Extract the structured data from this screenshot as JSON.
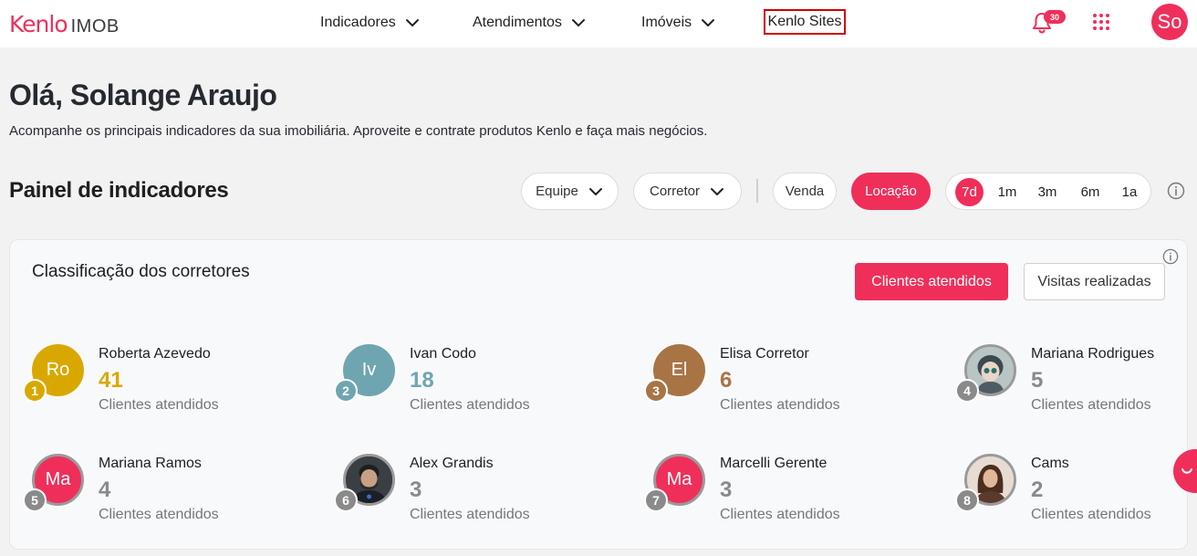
{
  "header": {
    "brand": "Kenlo",
    "product": "IMOB",
    "nav": [
      {
        "label": "Indicadores"
      },
      {
        "label": "Atendimentos"
      },
      {
        "label": "Imóveis"
      }
    ],
    "sites_label": "Kenlo Sites",
    "notifications_count": "30",
    "user_initials": "So",
    "accent_color": "#ef2f5a"
  },
  "greeting": {
    "title": "Olá, Solange Araujo",
    "subtitle": "Acompanhe os principais indicadores da sua imobiliária. Aproveite e contrate produtos Kenlo e faça mais negócios."
  },
  "panel": {
    "title": "Painel de indicadores",
    "filters": {
      "team": "Equipe",
      "broker": "Corretor",
      "sale": "Venda",
      "rent": "Locação",
      "active_type": "Locação"
    },
    "periods": [
      "7d",
      "1m",
      "3m",
      "6m",
      "1a"
    ],
    "active_period": "7d"
  },
  "ranking": {
    "title": "Classificação dos corretores",
    "tab_primary": "Clientes atendidos",
    "tab_secondary": "Visitas realizadas",
    "items": [
      {
        "rank": "1",
        "initials": "Ro",
        "name": "Roberta Azevedo",
        "count": "41",
        "label": "Clientes atendidos",
        "color": "#d9a800",
        "avatar": "initials"
      },
      {
        "rank": "2",
        "initials": "Iv",
        "name": "Ivan Codo",
        "count": "18",
        "label": "Clientes atendidos",
        "color": "#6fa5b1",
        "avatar": "initials"
      },
      {
        "rank": "3",
        "initials": "El",
        "name": "Elisa Corretor",
        "count": "6",
        "label": "Clientes atendidos",
        "color": "#a97444",
        "avatar": "initials"
      },
      {
        "rank": "4",
        "initials": "",
        "name": "Mariana Rodrigues",
        "count": "5",
        "label": "Clientes atendidos",
        "color": "#8a8a8a",
        "avatar": "photo"
      },
      {
        "rank": "5",
        "initials": "Ma",
        "name": "Mariana Ramos",
        "count": "4",
        "label": "Clientes atendidos",
        "color": "#8a8a8a",
        "avatar": "initials"
      },
      {
        "rank": "6",
        "initials": "",
        "name": "Alex Grandis",
        "count": "3",
        "label": "Clientes atendidos",
        "color": "#8a8a8a",
        "avatar": "photo"
      },
      {
        "rank": "7",
        "initials": "Ma",
        "name": "Marcelli Gerente",
        "count": "3",
        "label": "Clientes atendidos",
        "color": "#8a8a8a",
        "avatar": "initials"
      },
      {
        "rank": "8",
        "initials": "",
        "name": "Cams",
        "count": "2",
        "label": "Clientes atendidos",
        "color": "#8a8a8a",
        "avatar": "photo"
      }
    ]
  }
}
